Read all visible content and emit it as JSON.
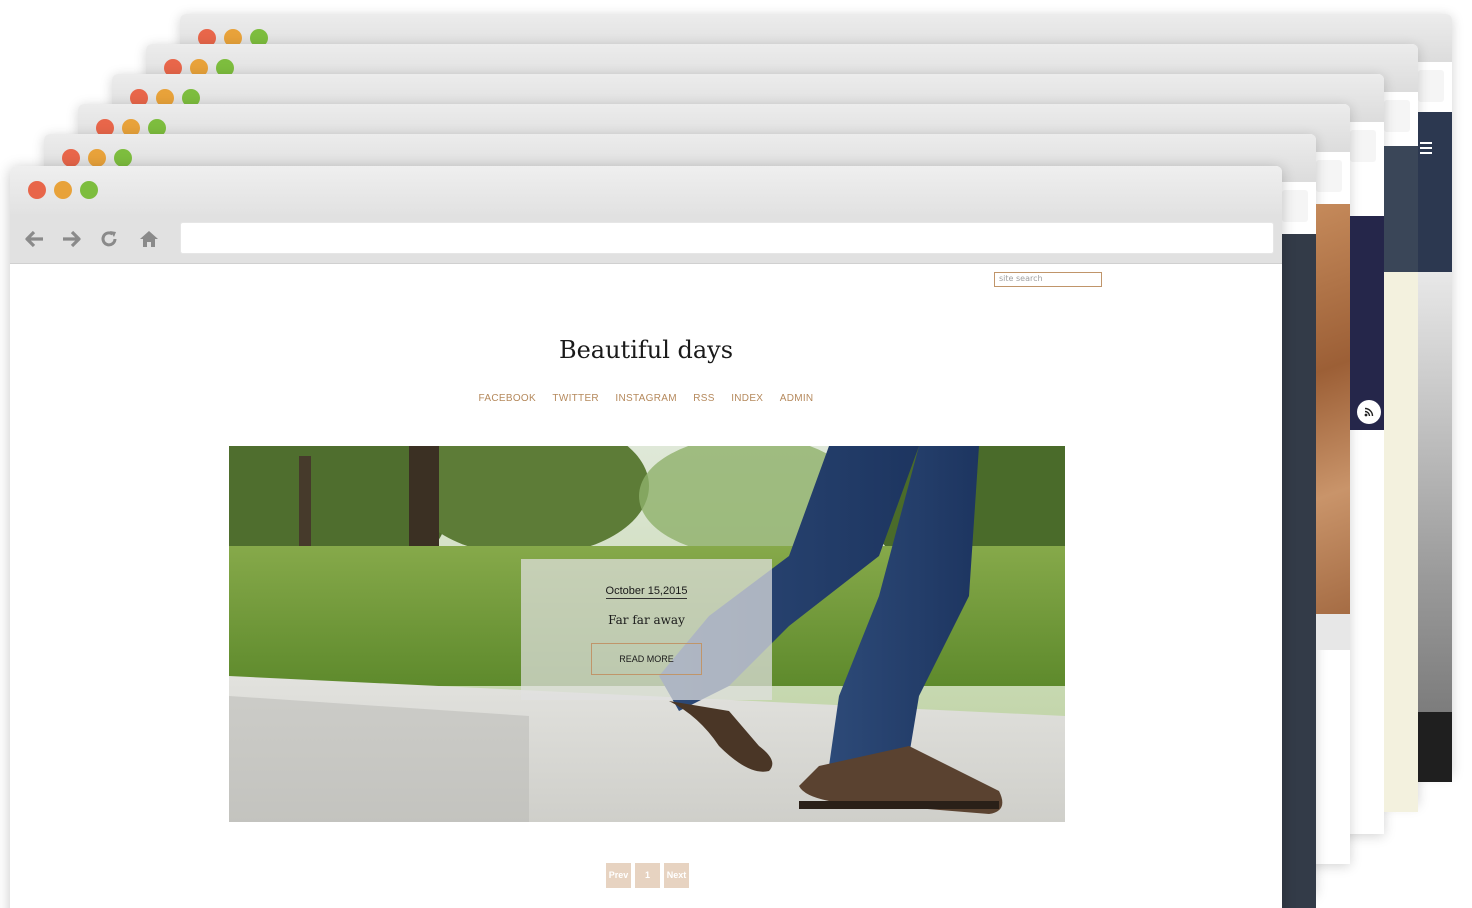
{
  "front_window": {
    "search": {
      "placeholder": "site search"
    },
    "site_title": "Beautiful days",
    "menu": [
      "FACEBOOK",
      "TWITTER",
      "INSTAGRAM",
      "RSS",
      "INDEX",
      "ADMIN"
    ],
    "featured_post": {
      "date": "October 15,2015",
      "title": "Far far away",
      "read_more": "READ MORE"
    },
    "pagination": {
      "prev": "Prev",
      "page": "1",
      "next": "Next"
    }
  },
  "icons": [
    "back-arrow-icon",
    "forward-arrow-icon",
    "reload-icon",
    "home-icon",
    "rss-icon",
    "hamburger-menu-icon"
  ],
  "colors": {
    "accent": "#b5895c",
    "traffic_red": "#e8664a",
    "traffic_yellow": "#e8a23a",
    "traffic_green": "#7dbd3e",
    "pager_bg": "#e7d3c1"
  }
}
